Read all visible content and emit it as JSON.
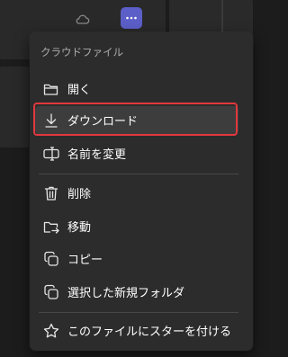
{
  "colors": {
    "accent": "#5b5fc7",
    "highlight_border": "#e2383d",
    "menu_bg": "#2c2c2c"
  },
  "toolbar": {
    "cloud_icon": "cloud-icon",
    "more_icon": "more-horizontal-icon"
  },
  "menu": {
    "header": "クラウドファイル",
    "items": [
      {
        "label": "開く",
        "icon": "folder-open-icon"
      },
      {
        "label": "ダウンロード",
        "icon": "download-icon",
        "highlighted": true
      },
      {
        "label": "名前を変更",
        "icon": "rename-icon"
      },
      {
        "label": "削除",
        "icon": "trash-icon"
      },
      {
        "label": "移動",
        "icon": "folder-move-icon"
      },
      {
        "label": "コピー",
        "icon": "copy-icon"
      },
      {
        "label": "選択した新規フォルダ",
        "icon": "copy-to-folder-icon"
      },
      {
        "label": "このファイルにスターを付ける",
        "icon": "star-icon"
      }
    ]
  }
}
